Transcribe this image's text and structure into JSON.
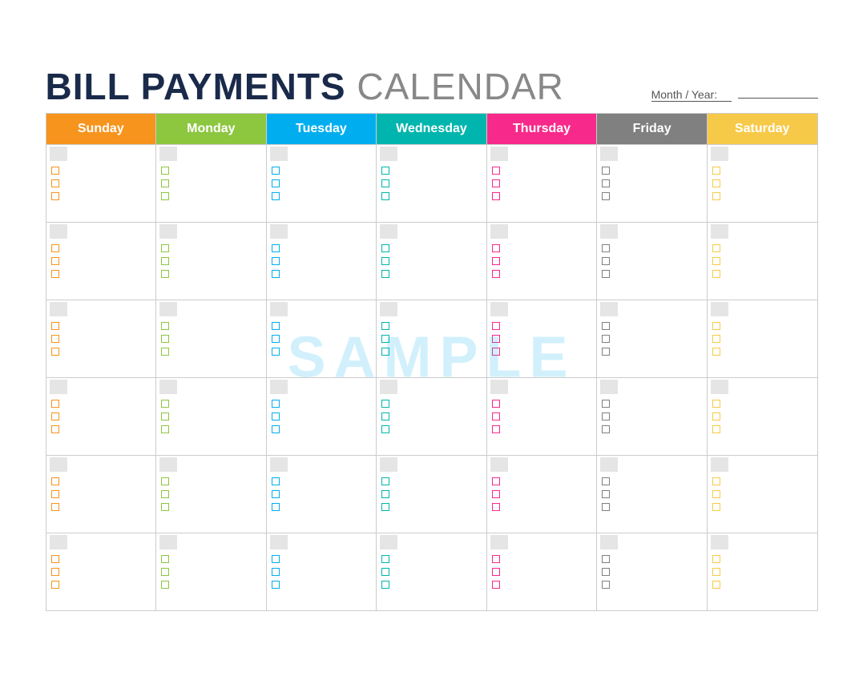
{
  "header": {
    "title_bold": "BILL PAYMENTS",
    "title_light": "CALENDAR",
    "month_year_label": "Month / Year:",
    "month_year_line": ""
  },
  "days": [
    {
      "label": "Sunday",
      "class": "th-sun",
      "col_class": "col-sun"
    },
    {
      "label": "Monday",
      "class": "th-mon",
      "col_class": "col-mon"
    },
    {
      "label": "Tuesday",
      "class": "th-tue",
      "col_class": "col-tue"
    },
    {
      "label": "Wednesday",
      "class": "th-wed",
      "col_class": "col-wed"
    },
    {
      "label": "Thursday",
      "class": "th-thu",
      "col_class": "col-thu"
    },
    {
      "label": "Friday",
      "class": "th-fri",
      "col_class": "col-fri"
    },
    {
      "label": "Saturday",
      "class": "th-sat",
      "col_class": "col-sat"
    }
  ],
  "weeks": 6,
  "checkboxes_per_day": 3,
  "sample_watermark": "SAMPLE"
}
